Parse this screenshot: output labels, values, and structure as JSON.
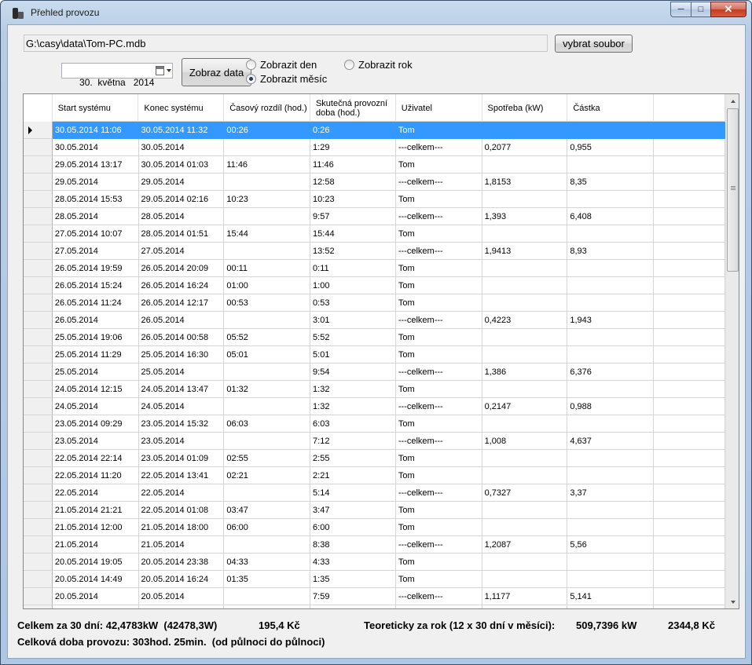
{
  "window": {
    "title": "Přehled provozu"
  },
  "file": {
    "path": "G:\\casy\\data\\Tom-PC.mdb",
    "select_label": "vybrat soubor"
  },
  "date_picker": {
    "value": "30.  května   2014"
  },
  "show_data_label": "Zobraz data",
  "radios": {
    "day": "Zobrazit den",
    "month": "Zobrazit měsíc",
    "year": "Zobrazit rok"
  },
  "table": {
    "headers": [
      "Start systému",
      "Konec systému",
      "Časový rozdíl (hod.)",
      "Skutečná provozní doba (hod.)",
      "Uživatel",
      "Spotřeba (kW)",
      "Částka"
    ],
    "rows": [
      [
        "30.05.2014 11:06",
        "30.05.2014 11:32",
        "00:26",
        "0:26",
        "Tom",
        "",
        ""
      ],
      [
        "30.05.2014",
        "30.05.2014",
        "",
        "1:29",
        "---celkem---",
        "0,2077",
        "0,955"
      ],
      [
        "29.05.2014 13:17",
        "30.05.2014 01:03",
        "11:46",
        "11:46",
        "Tom",
        "",
        ""
      ],
      [
        "29.05.2014",
        "29.05.2014",
        "",
        "12:58",
        "---celkem---",
        "1,8153",
        "8,35"
      ],
      [
        "28.05.2014 15:53",
        "29.05.2014 02:16",
        "10:23",
        "10:23",
        "Tom",
        "",
        ""
      ],
      [
        "28.05.2014",
        "28.05.2014",
        "",
        "9:57",
        "---celkem---",
        "1,393",
        "6,408"
      ],
      [
        "27.05.2014 10:07",
        "28.05.2014 01:51",
        "15:44",
        "15:44",
        "Tom",
        "",
        ""
      ],
      [
        "27.05.2014",
        "27.05.2014",
        "",
        "13:52",
        "---celkem---",
        "1,9413",
        "8,93"
      ],
      [
        "26.05.2014 19:59",
        "26.05.2014 20:09",
        "00:11",
        "0:11",
        "Tom",
        "",
        ""
      ],
      [
        "26.05.2014 15:24",
        "26.05.2014 16:24",
        "01:00",
        "1:00",
        "Tom",
        "",
        ""
      ],
      [
        "26.05.2014 11:24",
        "26.05.2014 12:17",
        "00:53",
        "0:53",
        "Tom",
        "",
        ""
      ],
      [
        "26.05.2014",
        "26.05.2014",
        "",
        "3:01",
        "---celkem---",
        "0,4223",
        "1,943"
      ],
      [
        "25.05.2014 19:06",
        "26.05.2014 00:58",
        "05:52",
        "5:52",
        "Tom",
        "",
        ""
      ],
      [
        "25.05.2014 11:29",
        "25.05.2014 16:30",
        "05:01",
        "5:01",
        "Tom",
        "",
        ""
      ],
      [
        "25.05.2014",
        "25.05.2014",
        "",
        "9:54",
        "---celkem---",
        "1,386",
        "6,376"
      ],
      [
        "24.05.2014 12:15",
        "24.05.2014 13:47",
        "01:32",
        "1:32",
        "Tom",
        "",
        ""
      ],
      [
        "24.05.2014",
        "24.05.2014",
        "",
        "1:32",
        "---celkem---",
        "0,2147",
        "0,988"
      ],
      [
        "23.05.2014 09:29",
        "23.05.2014 15:32",
        "06:03",
        "6:03",
        "Tom",
        "",
        ""
      ],
      [
        "23.05.2014",
        "23.05.2014",
        "",
        "7:12",
        "---celkem---",
        "1,008",
        "4,637"
      ],
      [
        "22.05.2014 22:14",
        "23.05.2014 01:09",
        "02:55",
        "2:55",
        "Tom",
        "",
        ""
      ],
      [
        "22.05.2014 11:20",
        "22.05.2014 13:41",
        "02:21",
        "2:21",
        "Tom",
        "",
        ""
      ],
      [
        "22.05.2014",
        "22.05.2014",
        "",
        "5:14",
        "---celkem---",
        "0,7327",
        "3,37"
      ],
      [
        "21.05.2014 21:21",
        "22.05.2014 01:08",
        "03:47",
        "3:47",
        "Tom",
        "",
        ""
      ],
      [
        "21.05.2014 12:00",
        "21.05.2014 18:00",
        "06:00",
        "6:00",
        "Tom",
        "",
        ""
      ],
      [
        "21.05.2014",
        "21.05.2014",
        "",
        "8:38",
        "---celkem---",
        "1,2087",
        "5,56"
      ],
      [
        "20.05.2014 19:05",
        "20.05.2014 23:38",
        "04:33",
        "4:33",
        "Tom",
        "",
        ""
      ],
      [
        "20.05.2014 14:49",
        "20.05.2014 16:24",
        "01:35",
        "1:35",
        "Tom",
        "",
        ""
      ],
      [
        "20.05.2014",
        "20.05.2014",
        "",
        "7:59",
        "---celkem---",
        "1,1177",
        "5,141"
      ],
      [
        "",
        "",
        "",
        "",
        "",
        "",
        ""
      ]
    ]
  },
  "summary": {
    "total_30": "Celkem za 30 dní: 42,4783kW  (42478,3W)",
    "total_30_price": "195,4 Kč",
    "total_time": "Celková doba provozu: 303hod. 25min.  (od půlnoci do půlnoci)",
    "year_label": "Teoreticky za rok (12 x 30 dní v měsíci):",
    "year_kw": "509,7396 kW",
    "year_price": "2344,8 Kč"
  }
}
